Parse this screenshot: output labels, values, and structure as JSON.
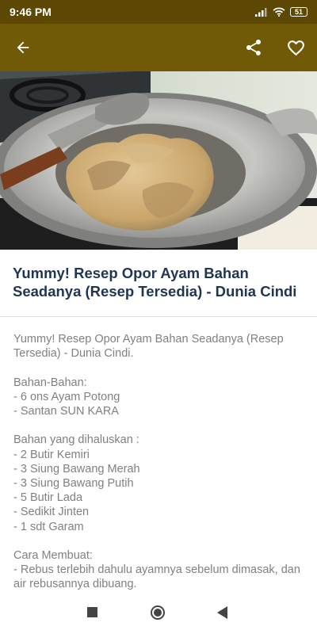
{
  "status_bar": {
    "time": "9:46 PM",
    "battery": "51"
  },
  "app_bar": {
    "back_icon": "arrow-back-icon",
    "share_icon": "share-icon",
    "favorite_icon": "heart-outline-icon",
    "color": "#705a08"
  },
  "hero_image": {
    "description_icon": "recipe-photo"
  },
  "recipe": {
    "title": "Yummy! Resep Opor Ayam Bahan Seadanya (Resep Tersedia) - Dunia Cindi",
    "body": "Yummy! Resep Opor Ayam Bahan Seadanya (Resep Tersedia) - Dunia Cindi.\n\nBahan-Bahan:\n- 6 ons Ayam Potong\n- Santan SUN KARA\n\nBahan yang dihaluskan :\n- 2 Butir Kemiri\n- 3 Siung Bawang Merah\n- 3 Siung Bawang Putih\n- 5 Butir Lada\n- Sedikit Jinten\n- 1 sdt Garam\n\nCara Membuat:\n- Rebus terlebih dahulu ayamnya sebelum dimasak, dan air rebusannya dibuang."
  },
  "nav_bar": {
    "recents_icon": "square-recents-icon",
    "home_icon": "circle-home-icon",
    "back_icon": "triangle-back-icon"
  }
}
